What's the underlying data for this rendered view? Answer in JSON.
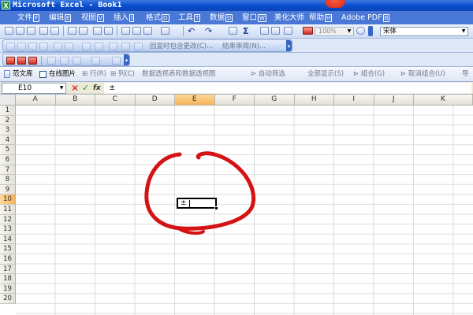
{
  "window": {
    "title": "Microsoft Excel - Book1",
    "app_icon": "X"
  },
  "menu": [
    {
      "label": "文件",
      "key": "F"
    },
    {
      "label": "编辑",
      "key": "E"
    },
    {
      "label": "视图",
      "key": "V"
    },
    {
      "label": "插入",
      "key": "I"
    },
    {
      "label": "格式",
      "key": "O"
    },
    {
      "label": "工具",
      "key": "T"
    },
    {
      "label": "数据",
      "key": "D"
    },
    {
      "label": "窗口",
      "key": "W"
    },
    {
      "label": "美化大师",
      "key": ""
    },
    {
      "label": "帮助",
      "key": "H"
    },
    {
      "label": "Adobe PDF",
      "key": "B"
    }
  ],
  "standard_toolbar": {
    "zoom": "100%",
    "font_name": "宋体",
    "autosum_symbol": "Σ"
  },
  "review_toolbar": {
    "reply_changes": "回复时包含更改(C)...",
    "end_review": "结束审阅(N)..."
  },
  "pivot_toolbar": {
    "template_library": "范文库",
    "online_pictures": "在线图片",
    "row": "行",
    "column": "列",
    "pivot_from_table": "数据透视表和数据透视图",
    "autofilter": "自动筛选",
    "show_all": "全部显示",
    "group": "组合",
    "ungroup": "取消组合",
    "more": "导"
  },
  "formula_bar": {
    "name_box": "E10",
    "content": "±",
    "cancel": "✕",
    "enter": "✓",
    "fx": "fx"
  },
  "columns": [
    "A",
    "B",
    "C",
    "D",
    "E",
    "F",
    "G",
    "H",
    "I",
    "J",
    "K"
  ],
  "rows": [
    "1",
    "2",
    "3",
    "4",
    "5",
    "6",
    "7",
    "8",
    "9",
    "10",
    "11",
    "12",
    "13",
    "14",
    "15",
    "16",
    "17",
    "18",
    "19",
    "20"
  ],
  "active_cell": {
    "ref": "E10",
    "column": "E",
    "row": "10",
    "value": "±"
  },
  "colors": {
    "title_bar": "#0a4fd0",
    "menu_bar": "#4a78d6",
    "annotation": "#d41414",
    "active_header": "#f5b45a"
  }
}
